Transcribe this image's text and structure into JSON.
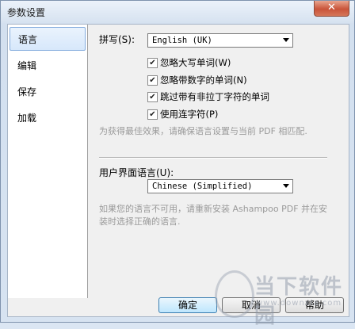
{
  "window": {
    "title": "参数设置",
    "close_glyph": "✕"
  },
  "sidebar": {
    "items": [
      {
        "label": "语言",
        "selected": true
      },
      {
        "label": "编辑",
        "selected": false
      },
      {
        "label": "保存",
        "selected": false
      },
      {
        "label": "加载",
        "selected": false
      }
    ]
  },
  "spelling": {
    "label": "拼写(S):",
    "selected": "English (UK)",
    "options": [
      {
        "label": "忽略大写单词(W)",
        "checked": true
      },
      {
        "label": "忽略带数字的单词(N)",
        "checked": true
      },
      {
        "label": "跳过带有非拉丁字符的单词",
        "checked": true
      },
      {
        "label": "使用连字符(P)",
        "checked": true
      }
    ],
    "hint": "为获得最佳效果，请确保语言设置与当前 PDF 相匹配."
  },
  "ui_language": {
    "label": "用户界面语言(U):",
    "selected": "Chinese (Simplified)",
    "hint": "如果您的语言不可用，请重新安装 Ashampoo PDF 并在安装时选择正确的语言."
  },
  "buttons": {
    "ok": "确定",
    "cancel": "取消",
    "help": "帮助"
  },
  "watermark": {
    "text": "当下软件园",
    "url": "www.downxia.com"
  },
  "colors": {
    "selection": "#d7e8fb",
    "selection_border": "#84acdd",
    "hint_text": "#9a9a9a"
  }
}
